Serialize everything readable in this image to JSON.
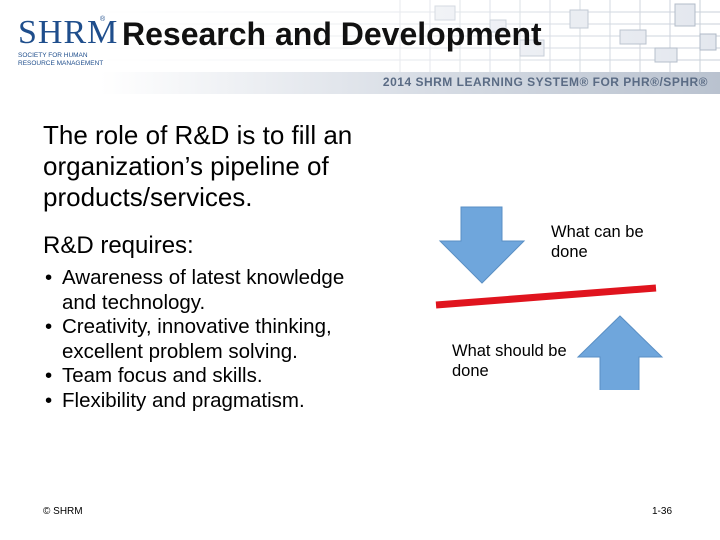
{
  "header": {
    "logo_word": "SHRM",
    "logo_reg": "®",
    "logo_tagline": "Society for Human Resource Management",
    "title": "Research and Development",
    "tagline": "2014 SHRM LEARNING SYSTEM® FOR PHR®/SPHR®"
  },
  "content": {
    "lead": "The role of R&D is to fill an organization’s pipeline of products/services.",
    "requires": "R&D requires:",
    "bullet_symbol": "•",
    "bullets": [
      "Awareness of latest knowledge and technology.",
      "Creativity, innovative thinking,  excellent problem solving.",
      "Team focus and skills.",
      "Flexibility and pragmatism."
    ]
  },
  "diagram": {
    "label_top": "What can be done",
    "label_bottom": "What should be done",
    "arrow_color": "#6fa6dc",
    "line_color": "#e0141e"
  },
  "footer": {
    "copyright": "© SHRM",
    "page": "1-36"
  }
}
